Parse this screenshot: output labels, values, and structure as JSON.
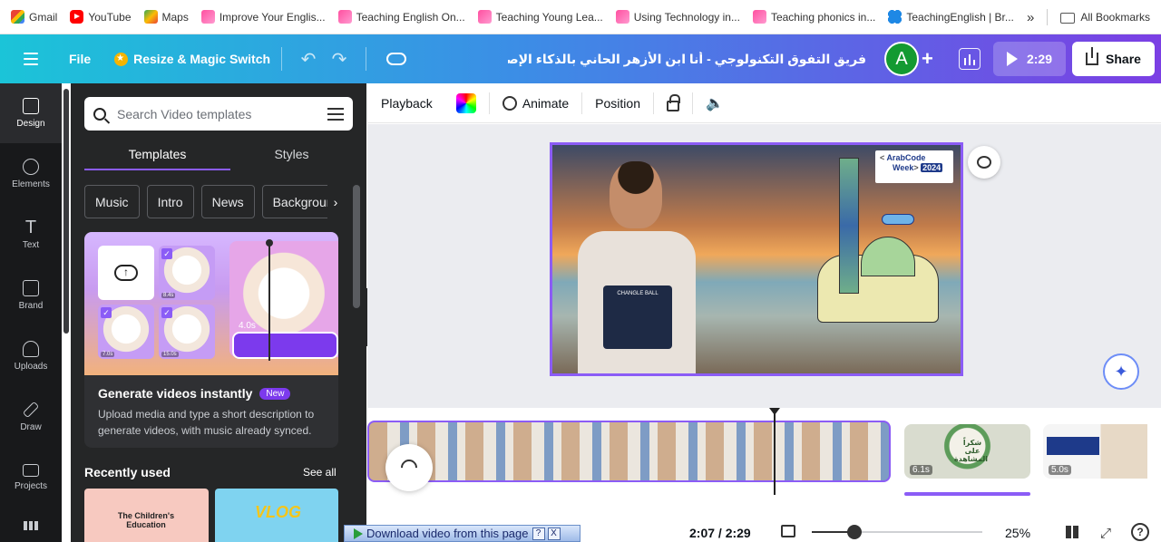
{
  "bookmarks": {
    "items": [
      {
        "label": "Gmail",
        "icon": "gmail-icon"
      },
      {
        "label": "YouTube",
        "icon": "youtube-icon"
      },
      {
        "label": "Maps",
        "icon": "maps-icon"
      },
      {
        "label": "Improve Your Englis...",
        "icon": "bookmark-favicon"
      },
      {
        "label": "Teaching English On...",
        "icon": "bookmark-favicon"
      },
      {
        "label": "Teaching Young Lea...",
        "icon": "bookmark-favicon"
      },
      {
        "label": "Using Technology in...",
        "icon": "bookmark-favicon"
      },
      {
        "label": "Teaching phonics in...",
        "icon": "bookmark-favicon"
      },
      {
        "label": "TeachingEnglish | Br...",
        "icon": "teachingenglish-icon"
      }
    ],
    "more": "»",
    "all_bookmarks": "All Bookmarks"
  },
  "header": {
    "file": "File",
    "resize": "Resize & Magic Switch",
    "undo_icon": "↶",
    "redo_icon": "↷",
    "title": "فريق التفوق التكنولوجي - أنا ابن الأزهر الحاني بالذكاء الإصطناعي",
    "avatar_letter": "A",
    "plus": "+",
    "play_duration": "2:29",
    "share": "Share"
  },
  "rail": {
    "items": [
      {
        "label": "Design"
      },
      {
        "label": "Elements"
      },
      {
        "label": "Text"
      },
      {
        "label": "Brand"
      },
      {
        "label": "Uploads"
      },
      {
        "label": "Draw"
      },
      {
        "label": "Projects"
      }
    ]
  },
  "panel": {
    "search_placeholder": "Search Video templates",
    "tabs": [
      "Templates",
      "Styles"
    ],
    "chips": [
      "Music",
      "Intro",
      "News",
      "Backgrounds"
    ],
    "chip_arrow": "›",
    "card": {
      "thumb_labels": [
        "8.4s",
        "7.0s",
        "15.0s"
      ],
      "big_label": "4.0s",
      "title": "Generate videos instantly",
      "badge": "New",
      "description": "Upload media and type a short description to generate videos, with music already synced."
    },
    "recent_title": "Recently used",
    "see_all": "See all",
    "recent": [
      {
        "title": "The Children's Education"
      },
      {
        "title": "VLOG"
      }
    ]
  },
  "toolbar": {
    "playback": "Playback",
    "animate": "Animate",
    "position": "Position"
  },
  "slide": {
    "logo_line1": "ArabCode",
    "logo_line2": "Week",
    "logo_year": "2024",
    "shirt_text": "CHANGLE BALL"
  },
  "timeline": {
    "clips": [
      {
        "duration": "6.1s",
        "text": "شكراً على المشاهدة"
      },
      {
        "duration": "5.0s"
      }
    ]
  },
  "bottombar": {
    "time": "2:07 / 2:29",
    "zoom": "25%",
    "zoom_fraction": 0.25,
    "fullscreen_icon": "⤢",
    "help": "?"
  },
  "download_bar": {
    "label": "Download video from this page",
    "help": "?",
    "close": "X"
  },
  "colors": {
    "accent": "#8b5cf6",
    "header_start": "#1bc4d8",
    "header_end": "#7b3fe4",
    "rail_bg": "#18191b",
    "panel_bg": "#252627"
  }
}
